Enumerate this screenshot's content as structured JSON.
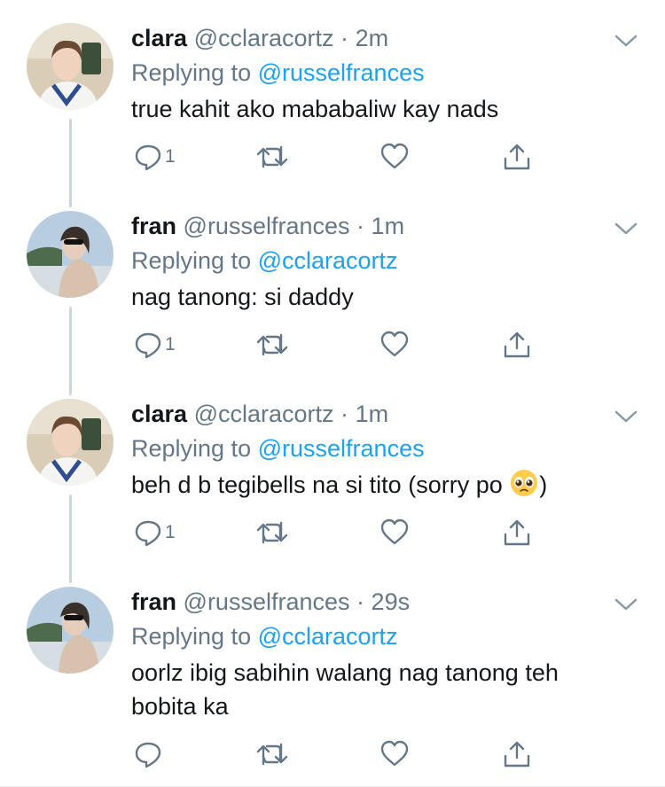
{
  "tweets": [
    {
      "name": "clara",
      "handle": "@cclaracortz",
      "dot": "·",
      "time": "2m",
      "reply_prefix": "Replying to",
      "reply_to": "@russelfrances",
      "text": "true kahit ako mababaliw kay nads",
      "reply_count": "1"
    },
    {
      "name": "fran",
      "handle": "@russelfrances",
      "dot": "·",
      "time": "1m",
      "reply_prefix": "Replying to",
      "reply_to": "@cclaracortz",
      "text": "nag tanong: si daddy",
      "reply_count": "1"
    },
    {
      "name": "clara",
      "handle": "@cclaracortz",
      "dot": "·",
      "time": "1m",
      "reply_prefix": "Replying to",
      "reply_to": "@russelfrances",
      "text_before_emoji": "beh d b tegibells na si tito (sorry po ",
      "text_after_emoji": ")",
      "emoji": "pleading-face-emoji",
      "reply_count": "1"
    },
    {
      "name": "fran",
      "handle": "@russelfrances",
      "dot": "·",
      "time": "29s",
      "reply_prefix": "Replying to",
      "reply_to": "@cclaracortz",
      "text": "oorlz ibig sabihin walang nag tanong teh bobita ka",
      "reply_count": ""
    }
  ],
  "colors": {
    "text": "#14171a",
    "secondary": "#657786",
    "link": "#1da1f2",
    "thread_line": "#ccd6dd"
  }
}
